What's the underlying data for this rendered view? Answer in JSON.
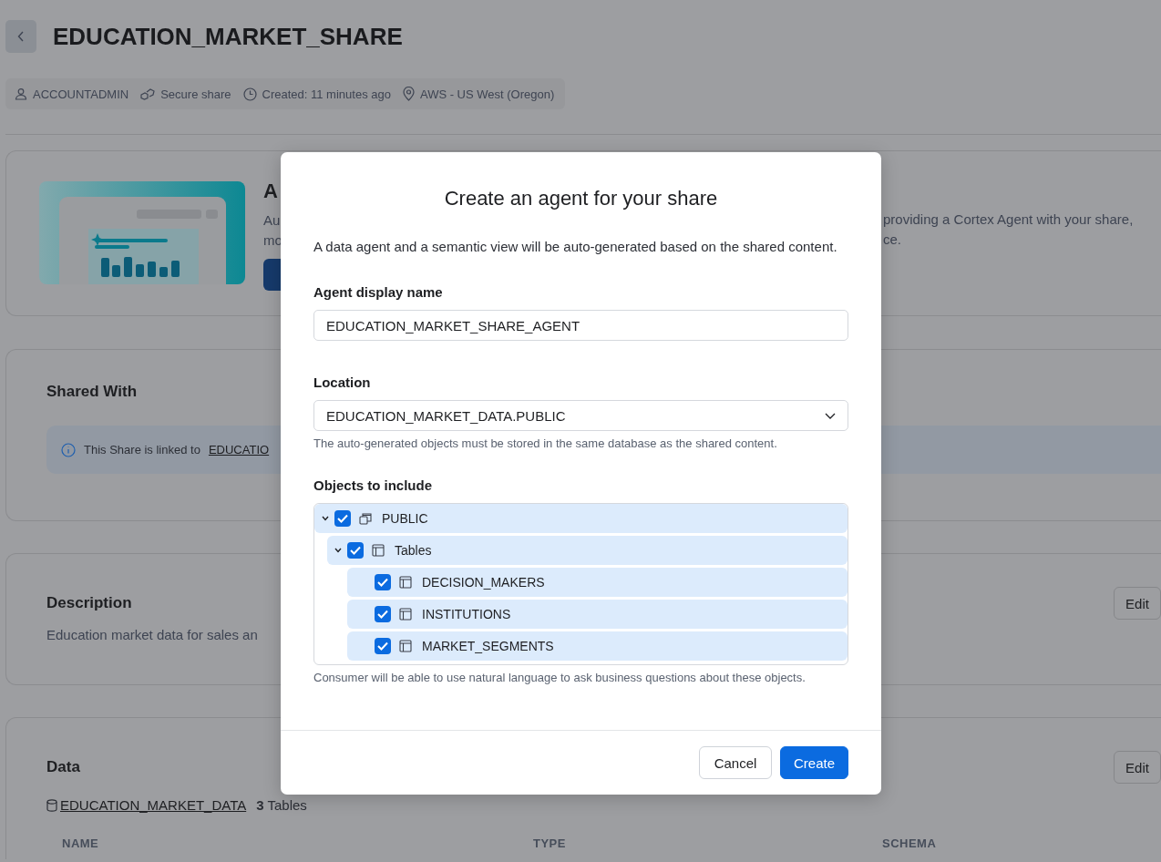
{
  "header": {
    "title": "EDUCATION_MARKET_SHARE"
  },
  "meta": [
    {
      "kind": "user",
      "text": "ACCOUNTADMIN"
    },
    {
      "kind": "share",
      "text": "Secure share"
    },
    {
      "kind": "clock",
      "text": "Created: 11 minutes ago"
    },
    {
      "kind": "location",
      "text": "AWS - US West (Oregon)"
    }
  ],
  "agent_card": {
    "title": "A",
    "text_left": [
      "Au",
      "mo"
    ],
    "text_right": [
      "providing a Cortex Agent with your share,",
      "ce."
    ]
  },
  "shared_with": {
    "title": "Shared With",
    "banner": {
      "text": "This Share is linked to",
      "link": "EDUCATIO"
    }
  },
  "description": {
    "title": "Description",
    "text": "Education market data for sales an",
    "edit": "Edit"
  },
  "data": {
    "title": "Data",
    "database": "EDUCATION_MARKET_DATA",
    "count": "**3** Tables",
    "edit": "Edit",
    "columns": [
      "NAME",
      "TYPE",
      "SCHEMA"
    ]
  },
  "dialog": {
    "title": "Create an agent for your share",
    "intro": "A data agent and a semantic view will be auto-generated based on the shared content.",
    "fields": [
      {
        "kind": "text",
        "label": "Agent display name",
        "value": "EDUCATION_MARKET_SHARE_AGENT"
      },
      {
        "kind": "select",
        "label": "Location",
        "value": "EDUCATION_MARKET_DATA.PUBLIC",
        "help": "The auto-generated objects must be stored in the same database as the shared content."
      }
    ],
    "objects": {
      "label": "Objects to include",
      "help": "Consumer will be able to use natural language to ask business questions about these objects.",
      "tree": [
        {
          "kind": "schema",
          "label": "PUBLIC",
          "checked": true,
          "expanded": true,
          "children": [
            {
              "kind": "folder",
              "label": "Tables",
              "checked": true,
              "expanded": true,
              "children": [
                {
                  "kind": "table",
                  "label": "DECISION_MAKERS",
                  "checked": true
                },
                {
                  "kind": "table",
                  "label": "INSTITUTIONS",
                  "checked": true
                },
                {
                  "kind": "table",
                  "label": "MARKET_SEGMENTS",
                  "checked": true
                }
              ]
            }
          ]
        }
      ]
    },
    "buttons": [
      {
        "kind": "secondary",
        "label": "Cancel"
      },
      {
        "kind": "primary",
        "label": "Create"
      }
    ]
  }
}
